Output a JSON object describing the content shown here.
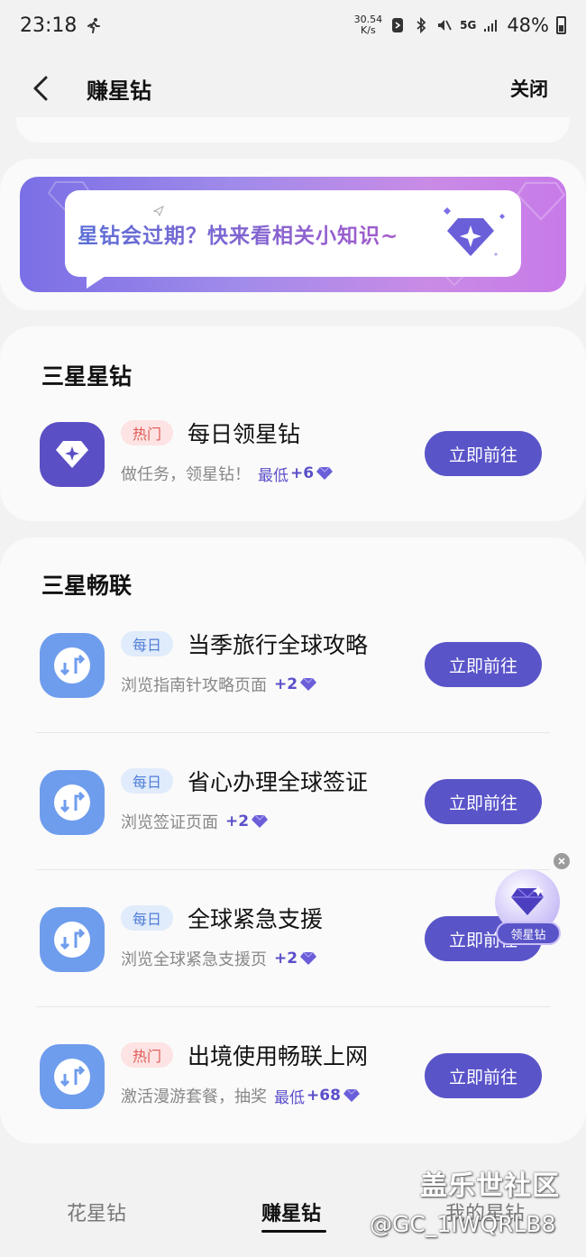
{
  "status_bar": {
    "time": "23:18",
    "net_speed_value": "30.54",
    "net_speed_unit": "K/s",
    "network": "5G",
    "battery": "48%"
  },
  "header": {
    "title": "赚星钻",
    "close_label": "关闭"
  },
  "banner": {
    "text": "星钻会过期？快来看相关小知识~"
  },
  "sections": [
    {
      "title": "三星星钻",
      "tasks": [
        {
          "badge": "热门",
          "name": "每日领星钻",
          "desc": "做任务，领星钻！",
          "reward_prefix": "最低",
          "reward": "+6",
          "button": "立即前往"
        }
      ]
    },
    {
      "title": "三星畅联",
      "tasks": [
        {
          "badge": "每日",
          "name": "当季旅行全球攻略",
          "desc": "浏览指南针攻略页面",
          "reward_prefix": "",
          "reward": "+2",
          "button": "立即前往"
        },
        {
          "badge": "每日",
          "name": "省心办理全球签证",
          "desc": "浏览签证页面",
          "reward_prefix": "",
          "reward": "+2",
          "button": "立即前往"
        },
        {
          "badge": "每日",
          "name": "全球紧急支援",
          "desc": "浏览全球紧急支援页",
          "reward_prefix": "",
          "reward": "+2",
          "button": "立即前往"
        },
        {
          "badge": "热门",
          "name": "出境使用畅联上网",
          "desc": "激活漫游套餐，抽奖",
          "reward_prefix": "最低",
          "reward": "+68",
          "button": "立即前往"
        }
      ]
    }
  ],
  "float_widget": {
    "label": "领星钻"
  },
  "bottom_nav": {
    "items": [
      {
        "label": "花星钻"
      },
      {
        "label": "赚星钻"
      },
      {
        "label": "我的星钻"
      }
    ],
    "active_index": 1
  },
  "watermark": {
    "site": "盖乐世社区",
    "user": "@GC_1IWQRLB8"
  },
  "colors": {
    "accent": "#5a54c9",
    "hot_badge_bg": "#fde3e3",
    "hot_badge_text": "#e05a55",
    "daily_badge_bg": "#e0ebfb",
    "daily_badge_text": "#4f7ed6",
    "changlian_icon": "#6f9ded"
  }
}
